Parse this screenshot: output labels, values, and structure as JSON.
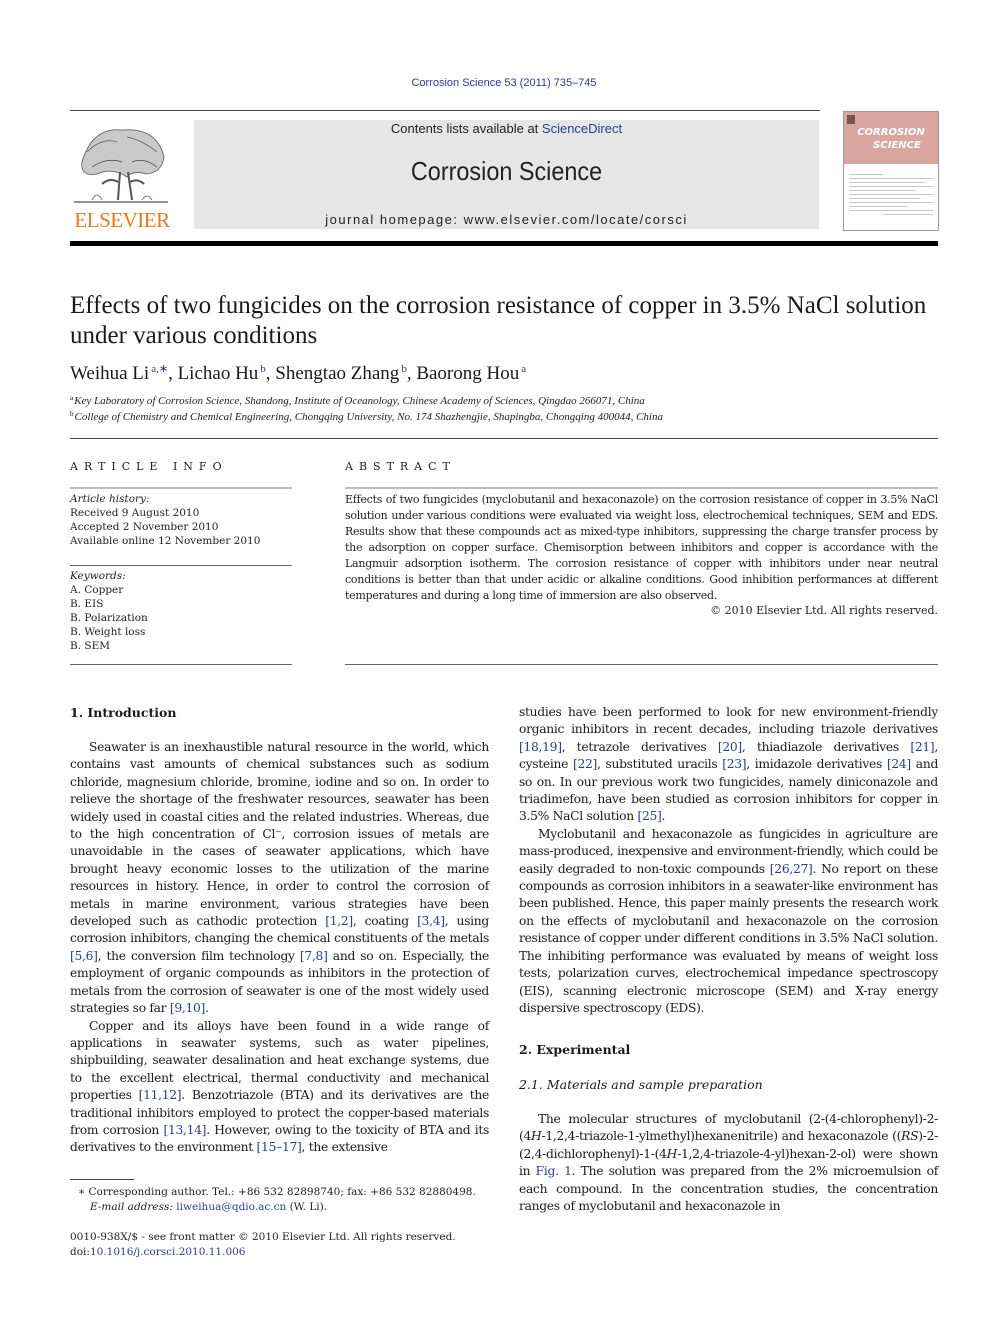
{
  "header": {
    "journal_ref": "Corrosion Science 53 (2011) 735–745",
    "contents_prefix": "Contents lists available at ",
    "contents_link": "ScienceDirect",
    "journal_title": "Corrosion Science",
    "homepage": "journal homepage: www.elsevier.com/locate/corsci",
    "publisher_logo": "ELSEVIER",
    "cover_title_line1": "CORROSION",
    "cover_title_line2": "SCIENCE"
  },
  "article": {
    "title": "Effects of two fungicides on the corrosion resistance of copper in 3.5% NaCl solution under various conditions",
    "authors": [
      {
        "name": "Weihua Li",
        "sup": "a,∗",
        "sep": ", "
      },
      {
        "name": "Lichao Hu",
        "sup": "b",
        "sep": ", "
      },
      {
        "name": "Shengtao Zhang",
        "sup": "b",
        "sep": ", "
      },
      {
        "name": "Baorong Hou",
        "sup": "a",
        "sep": ""
      }
    ],
    "affiliations": [
      {
        "mark": "a",
        "text": "Key Laboratory of Corrosion Science, Shandong, Institute of Oceanology, Chinese Academy of Sciences, Qingdao 266071, China"
      },
      {
        "mark": "b",
        "text": "College of Chemistry and Chemical Engineering, Chongqing University, No. 174 Shazhengjie, Shapingba, Chongqing 400044, China"
      }
    ]
  },
  "article_info": {
    "heading": "ARTICLE INFO",
    "history_label": "Article history:",
    "history": [
      "Received 9 August 2010",
      "Accepted 2 November 2010",
      "Available online 12 November 2010"
    ],
    "keywords_label": "Keywords:",
    "keywords": [
      "A. Copper",
      "B. EIS",
      "B. Polarization",
      "B. Weight loss",
      "B. SEM"
    ]
  },
  "abstract": {
    "heading": "ABSTRACT",
    "text": "Effects of two fungicides (myclobutanil and hexaconazole) on the corrosion resistance of copper in 3.5% NaCl solution under various conditions were evaluated via weight loss, electrochemical techniques, SEM and EDS. Results show that these compounds act as mixed-type inhibitors, suppressing the charge transfer process by the adsorption on copper surface. Chemisorption between inhibitors and copper is accordance with the Langmuir adsorption isotherm. The corrosion resistance of copper with inhibitors under near neutral conditions is better than that under acidic or alkaline conditions. Good inhibition performances at different temperatures and during a long time of immersion are also observed.",
    "copyright": "© 2010 Elsevier Ltd. All rights reserved."
  },
  "body": {
    "intro_heading": "1. Introduction",
    "intro_p1": [
      {
        "t": "Seawater is an inexhaustible natural resource in the world, which contains vast amounts of chemical substances such as sodium chloride, magnesium chloride, bromine, iodine and so on. In order to relieve the shortage of the freshwater resources, seawater has been widely used in coastal cities and the related industries. Whereas, due to the high concentration of Cl⁻, corrosion issues of metals are unavoidable in the cases of seawater applications, which have brought heavy economic losses to the utilization of the marine resources in history. Hence, in order to control the corrosion of metals in marine environment, various strategies have been developed such as cathodic protection "
      },
      {
        "ref": "[1,2]"
      },
      {
        "t": ", coating "
      },
      {
        "ref": "[3,4]"
      },
      {
        "t": ", using corrosion inhibitors, changing the chemical constituents of the metals "
      },
      {
        "ref": "[5,6]"
      },
      {
        "t": ", the conversion film technology "
      },
      {
        "ref": "[7,8]"
      },
      {
        "t": " and so on. Especially, the employment of organic compounds as inhibitors in the protection of metals from the corrosion of seawater is one of the most widely used strategies so far "
      },
      {
        "ref": "[9,10]"
      },
      {
        "t": "."
      }
    ],
    "intro_p2": [
      {
        "t": "Copper and its alloys have been found in a wide range of applications in seawater systems, such as water pipelines, shipbuilding, seawater desalination and heat exchange systems, due to the excellent electrical, thermal conductivity and mechanical properties "
      },
      {
        "ref": "[11,12]"
      },
      {
        "t": ". Benzotriazole (BTA) and its derivatives are the traditional inhibitors employed to protect the copper-based materials from corrosion "
      },
      {
        "ref": "[13,14]"
      },
      {
        "t": ". However, owing to the toxicity of BTA and its derivatives to the environment "
      },
      {
        "ref": "[15–17]"
      },
      {
        "t": ", the extensive"
      }
    ],
    "right_p1": [
      {
        "t": "studies have been performed to look for new environment-friendly organic inhibitors in recent decades, including triazole derivatives "
      },
      {
        "ref": "[18,19]"
      },
      {
        "t": ", tetrazole derivatives "
      },
      {
        "ref": "[20]"
      },
      {
        "t": ", thiadiazole derivatives "
      },
      {
        "ref": "[21]"
      },
      {
        "t": ", cysteine "
      },
      {
        "ref": "[22]"
      },
      {
        "t": ", substituted uracils "
      },
      {
        "ref": "[23]"
      },
      {
        "t": ", imidazole derivatives "
      },
      {
        "ref": "[24]"
      },
      {
        "t": " and so on. In our previous work two fungicides, namely diniconazole and triadimefon, have been studied as corrosion inhibitors for copper in 3.5% NaCl solution "
      },
      {
        "ref": "[25]"
      },
      {
        "t": "."
      }
    ],
    "right_p2": [
      {
        "t": "Myclobutanil and hexaconazole as fungicides in agriculture are mass-produced, inexpensive and environment-friendly, which could be easily degraded to non-toxic compounds "
      },
      {
        "ref": "[26,27]"
      },
      {
        "t": ". No report on these compounds as corrosion inhibitors in a seawater-like environment has been published. Hence, this paper mainly presents the research work on the effects of myclobutanil and hexaconazole on the corrosion resistance of copper under different conditions in 3.5% NaCl solution. The inhibiting performance was evaluated by means of weight loss tests, polarization curves, electrochemical impedance spectroscopy (EIS), scanning electronic microscope (SEM) and X-ray energy dispersive spectroscopy (EDS)."
      }
    ],
    "exp_heading": "2. Experimental",
    "exp_sub": "2.1. Materials and sample preparation",
    "exp_p1": [
      {
        "t": "The molecular structures of myclobutanil (2-(4-chlorophenyl)-2-(4"
      },
      {
        "i": "H"
      },
      {
        "t": "-1,2,4-triazole-1-ylmethyl)hexanenitrile) and hexaconazole (("
      },
      {
        "i": "RS"
      },
      {
        "t": ")-2-(2,4-dichlorophenyl)-1-(4"
      },
      {
        "i": "H"
      },
      {
        "t": "-1,2,4-triazole-4-yl)hexan-2-ol) were shown in "
      },
      {
        "ref": "Fig. 1"
      },
      {
        "t": ". The solution was prepared from the 2% microemulsion of each compound. In the concentration studies, the concentration ranges of myclobutanil and hexaconazole in"
      }
    ]
  },
  "footnotes": {
    "corresponding": "∗  Corresponding author. Tel.: +86 532 82898740; fax: +86 532 82880498.",
    "email_label": "E-mail address: ",
    "email": "liweihua@qdio.ac.cn",
    "email_suffix": " (W. Li).",
    "issn": "0010-938X/$ - see front matter © 2010 Elsevier Ltd. All rights reserved.",
    "doi_label": "doi:",
    "doi": "10.1016/j.corsci.2010.11.006"
  },
  "colors": {
    "link": "#2b3d8f",
    "elsevier_orange": "#e87722",
    "banner_bg": "#e6e6e6",
    "cover_pink": "#d9a7a0"
  }
}
